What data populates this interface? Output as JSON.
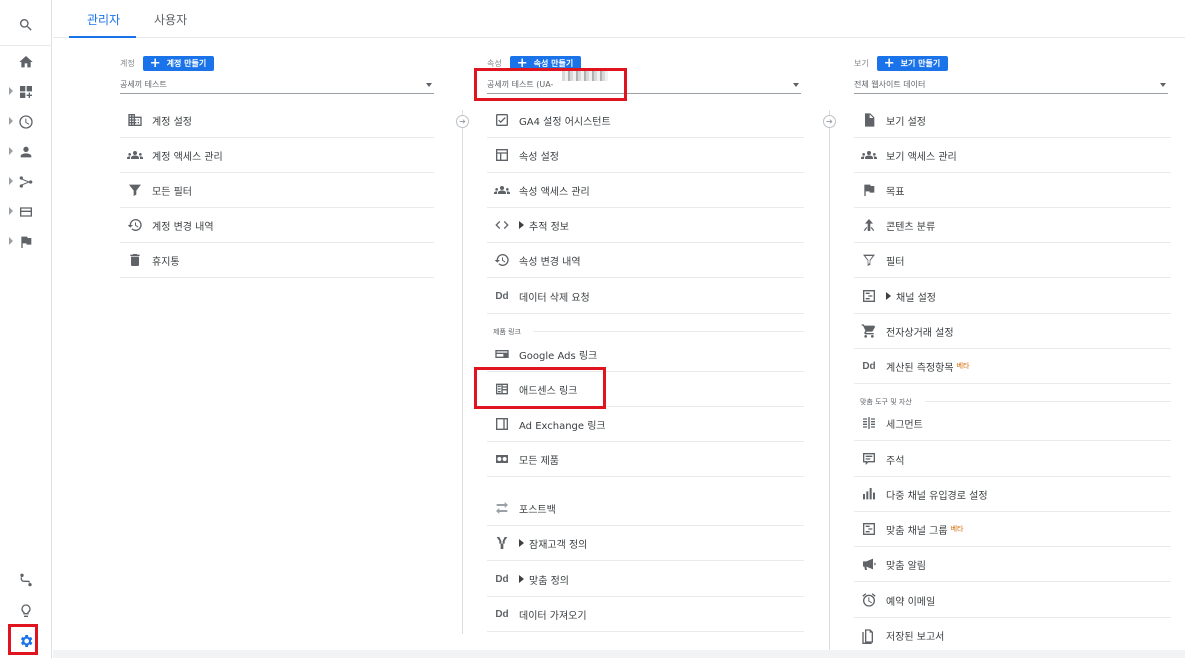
{
  "tabs": [
    {
      "label": "관리자",
      "active": true
    },
    {
      "label": "사용자",
      "active": false
    }
  ],
  "rail": {
    "icons": [
      "search-icon",
      "home-icon",
      "customization-icon",
      "realtime-icon",
      "audience-icon",
      "acquisition-icon",
      "behavior-icon",
      "conversions-icon",
      "attribution-icon",
      "discover-icon",
      "admin-gear-icon"
    ]
  },
  "account": {
    "label": "계정",
    "create_label": "계정 만들기",
    "selected": "공세끼 테스트",
    "items": [
      {
        "icon": "building-icon",
        "label": "계정 설정"
      },
      {
        "icon": "people-icon",
        "label": "계정 액세스 관리"
      },
      {
        "icon": "filter-icon",
        "label": "모든 필터"
      },
      {
        "icon": "history-icon",
        "label": "계정 변경 내역"
      },
      {
        "icon": "trash-icon",
        "label": "휴지통"
      }
    ]
  },
  "property": {
    "label": "속성",
    "create_label": "속성 만들기",
    "selected": "공세끼 테스트 (UA-",
    "items": [
      {
        "icon": "checkbox-icon",
        "label": "GA4 설정 어시스턴트"
      },
      {
        "icon": "layout-icon",
        "label": "속성 설정"
      },
      {
        "icon": "people-icon",
        "label": "속성 액세스 관리"
      },
      {
        "icon": "code-icon",
        "label": "추적 정보",
        "expand": true
      },
      {
        "icon": "history-icon",
        "label": "속성 변경 내역"
      },
      {
        "icon": "dd-icon",
        "label": "데이터 삭제 요청"
      }
    ],
    "product_links_title": "제품 링크",
    "product_links": [
      {
        "icon": "google-ads-icon",
        "label": "Google Ads 링크"
      },
      {
        "icon": "adsense-icon",
        "label": "애드센스 링크"
      },
      {
        "icon": "ad-exchange-icon",
        "label": "Ad Exchange 링크"
      },
      {
        "icon": "all-products-icon",
        "label": "모든 제품"
      }
    ],
    "other_items": [
      {
        "icon": "postback-icon",
        "label": "포스트백"
      },
      {
        "icon": "audience-def-icon",
        "label": "잠재고객 정의",
        "expand": true
      },
      {
        "icon": "dd-icon",
        "label": "맞춤 정의",
        "expand": true
      },
      {
        "icon": "dd-icon",
        "label": "데이터 가져오기"
      }
    ]
  },
  "view": {
    "label": "보기",
    "create_label": "보기 만들기",
    "selected": "전체 웹사이트 데이터",
    "items": [
      {
        "icon": "document-icon",
        "label": "보기 설정"
      },
      {
        "icon": "people-icon",
        "label": "보기 액세스 관리"
      },
      {
        "icon": "flag-icon",
        "label": "목표"
      },
      {
        "icon": "content-group-icon",
        "label": "콘텐츠 분류"
      },
      {
        "icon": "filter-icon",
        "label": "필터"
      },
      {
        "icon": "channel-icon",
        "label": "채널 설정",
        "expand": true
      },
      {
        "icon": "cart-icon",
        "label": "전자상거래 설정"
      },
      {
        "icon": "dd-icon",
        "label": "계산된 측정항목",
        "beta": "베타"
      }
    ],
    "tools_title": "맞춤 도구 및 자산",
    "tools": [
      {
        "icon": "segments-icon",
        "label": "세그먼트"
      },
      {
        "icon": "annotation-icon",
        "label": "주석"
      },
      {
        "icon": "bar-chart-icon",
        "label": "다중 채널 유입경로 설정"
      },
      {
        "icon": "channel-icon",
        "label": "맞춤 채널 그룹",
        "beta": "베타"
      },
      {
        "icon": "megaphone-icon",
        "label": "맞춤 알림"
      },
      {
        "icon": "alarm-icon",
        "label": "예약 이메일"
      },
      {
        "icon": "report-icon",
        "label": "저장된 보고서"
      }
    ]
  },
  "colors": {
    "accent": "#1a73e8",
    "highlight": "#e0141e"
  }
}
